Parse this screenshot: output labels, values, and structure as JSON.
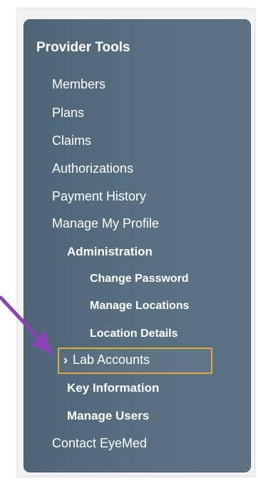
{
  "panel": {
    "title": "Provider Tools"
  },
  "nav": {
    "items": [
      {
        "label": "Members"
      },
      {
        "label": "Plans"
      },
      {
        "label": "Claims"
      },
      {
        "label": "Authorizations"
      },
      {
        "label": "Payment History"
      },
      {
        "label": "Manage My Profile"
      }
    ],
    "administration": {
      "label": "Administration"
    },
    "admin_sub": [
      {
        "label": "Change Password"
      },
      {
        "label": "Manage Locations"
      },
      {
        "label": "Location Details"
      }
    ],
    "active": {
      "label": "Lab Accounts",
      "chevron": "›"
    },
    "profile_sub": [
      {
        "label": "Key Information"
      },
      {
        "label": "Manage Users"
      }
    ],
    "contact": {
      "label": "Contact EyeMed"
    }
  },
  "colors": {
    "panel": "#587082",
    "highlight_border": "#e3a83a",
    "annotation_arrow": "#8a44b4"
  },
  "icons": {
    "active_marker": "chevron-right-icon",
    "annotation": "arrow-icon"
  }
}
